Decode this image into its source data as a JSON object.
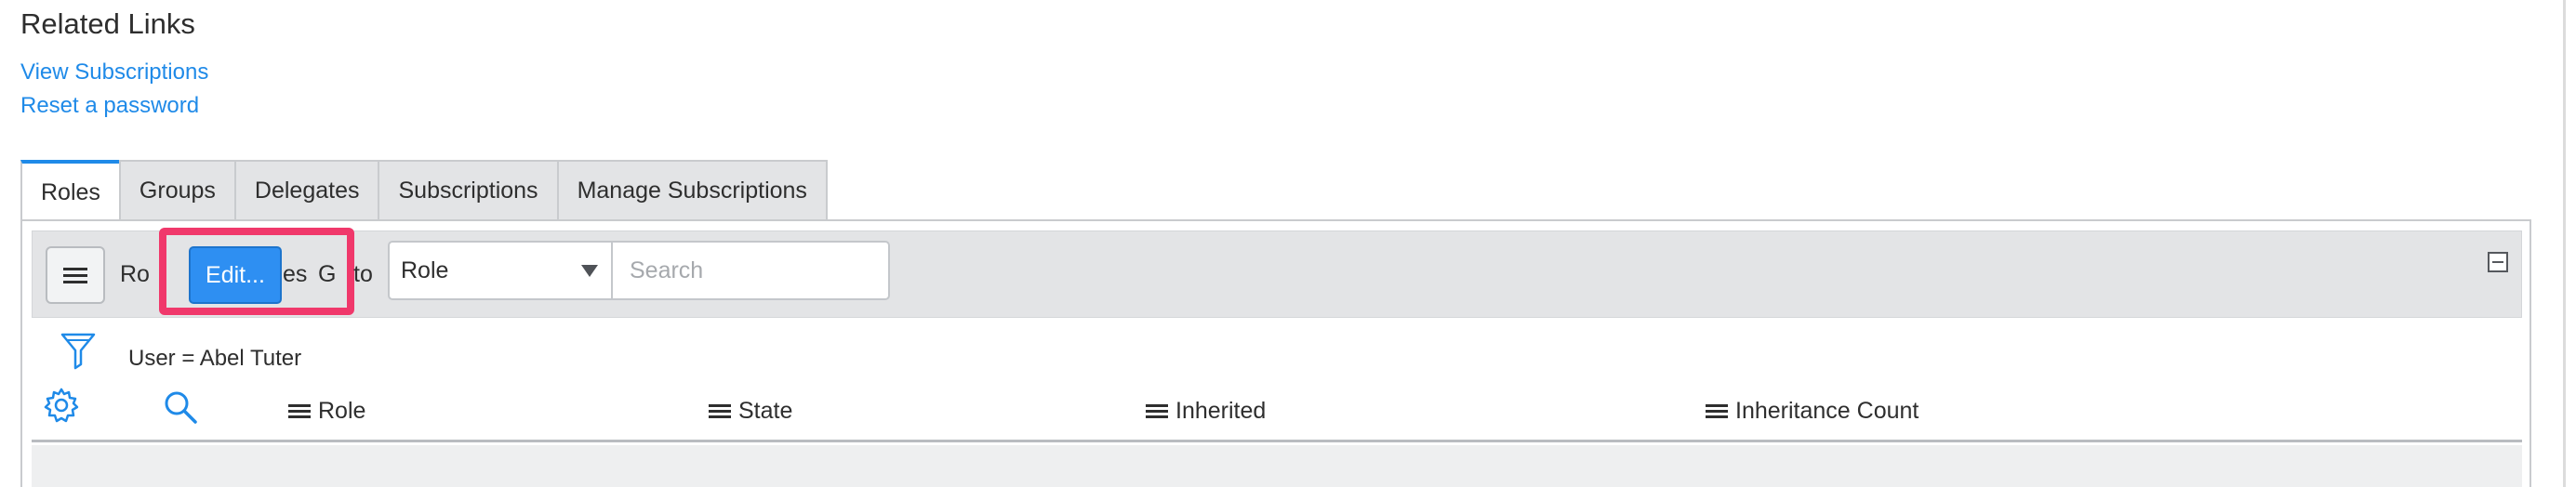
{
  "related": {
    "title": "Related Links",
    "links": [
      "View Subscriptions",
      "Reset a password"
    ]
  },
  "tabs": [
    {
      "label": "Roles",
      "active": true
    },
    {
      "label": "Groups",
      "active": false
    },
    {
      "label": "Delegates",
      "active": false
    },
    {
      "label": "Subscriptions",
      "active": false
    },
    {
      "label": "Manage Subscriptions",
      "active": false
    }
  ],
  "toolbar": {
    "menu_icon": "hamburger-menu-icon",
    "roles_prefix": "Ro",
    "roles_suffix": "es",
    "edit_label": "Edit...",
    "goto_prefix": "G",
    "goto_suffix": "to",
    "select_value": "Role",
    "search_placeholder": "Search",
    "collapse_icon": "collapse-icon"
  },
  "filter": {
    "icon": "filter-icon",
    "text": "User = Abel Tuter"
  },
  "columns": {
    "settings_icon": "gear-icon",
    "search_icon": "search-icon",
    "headers": [
      "Role",
      "State",
      "Inherited",
      "Inheritance Count"
    ]
  },
  "colors": {
    "accent": "#1f8ae8",
    "edit_button": "#2e8ff2",
    "highlight": "#f0386b",
    "toolbar_bg": "#e3e4e6"
  }
}
